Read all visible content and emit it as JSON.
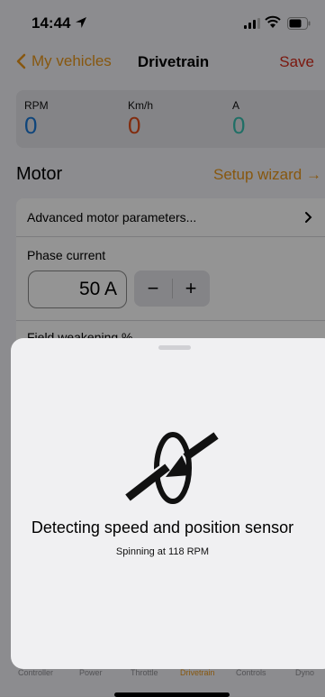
{
  "status_bar": {
    "time": "14:44"
  },
  "nav": {
    "back_label": "My vehicles",
    "title": "Drivetrain",
    "save_label": "Save"
  },
  "gauges": [
    {
      "label": "RPM",
      "value": "0",
      "color": "#1a78d4"
    },
    {
      "label": "Km/h",
      "value": "0",
      "color": "#e04a18"
    },
    {
      "label": "A",
      "value": "0",
      "color": "#38bfb0"
    }
  ],
  "motor": {
    "heading": "Motor",
    "setup_wizard_label": "Setup wizard",
    "advanced_label": "Advanced motor parameters...",
    "phase_current_label": "Phase current",
    "phase_current_value": "50 A",
    "stepper_minus": "−",
    "stepper_plus": "+",
    "field_weakening_label": "Field weakening %"
  },
  "tabs": [
    {
      "label": "Controller",
      "active": false
    },
    {
      "label": "Power",
      "active": false
    },
    {
      "label": "Throttle",
      "active": false
    },
    {
      "label": "Drivetrain",
      "active": true
    },
    {
      "label": "Controls",
      "active": false
    },
    {
      "label": "Dyno",
      "active": false
    }
  ],
  "sheet": {
    "icon": "speed-sensor-rotation-icon",
    "title": "Detecting speed and position sensor",
    "subtitle": "Spinning at 118 RPM"
  },
  "colors": {
    "accent": "#e8971a",
    "save": "#d42a1a"
  }
}
